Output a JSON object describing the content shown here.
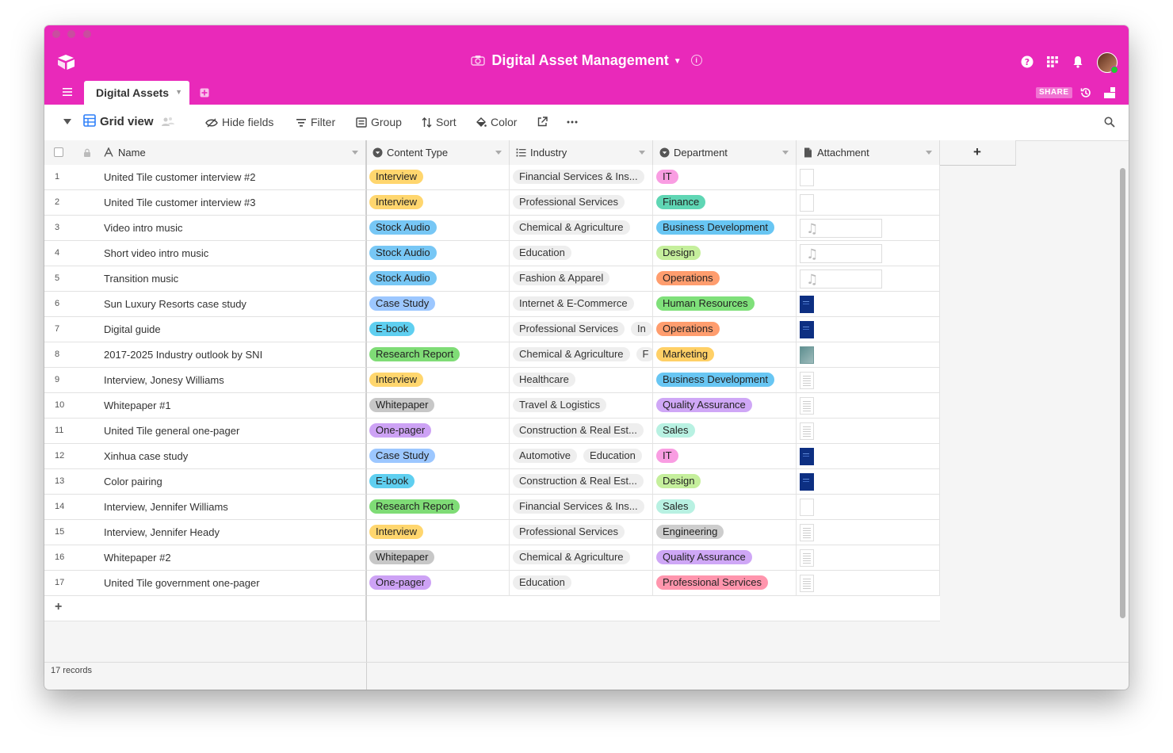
{
  "window": {
    "title": "Digital Asset Management"
  },
  "tabs": [
    {
      "label": "Digital Assets",
      "active": true
    }
  ],
  "share_label": "SHARE",
  "toolbar": {
    "view_name": "Grid view",
    "hide_fields": "Hide fields",
    "filter": "Filter",
    "group": "Group",
    "sort": "Sort",
    "color": "Color"
  },
  "columns": {
    "name": "Name",
    "content_type": "Content Type",
    "industry": "Industry",
    "department": "Department",
    "attachment": "Attachment",
    "add": "+"
  },
  "colors": {
    "titlebar": "#e929ba",
    "Interview": "#ffd66e",
    "Stock Audio": "#77c7f5",
    "Case Study": "#9cc7ff",
    "E-book": "#5fcff0",
    "Research Report": "#7fdc76",
    "Whitepaper": "#c7c7c7",
    "One-pager": "#cda2f5",
    "IT": "#f99de2",
    "Finance": "#5fd6b4",
    "Business Development": "#68c6f3",
    "Design": "#c5ef9c",
    "Operations": "#ff9d6e",
    "Human Resources": "#7fe07a",
    "Marketing": "#ffd066",
    "Quality Assurance": "#cfa7f6",
    "Sales": "#b8f1e2",
    "Engineering": "#cdcdcd",
    "Professional Services": "#ff95ad"
  },
  "rows": [
    {
      "num": "1",
      "name": "United Tile customer interview #2",
      "content_type": "Interview",
      "industry": [
        "Financial Services & Ins..."
      ],
      "department": "IT",
      "attachment": "doc-blank"
    },
    {
      "num": "2",
      "name": "United Tile customer interview #3",
      "content_type": "Interview",
      "industry": [
        "Professional Services"
      ],
      "department": "Finance",
      "attachment": "doc-blank"
    },
    {
      "num": "3",
      "name": "Video intro music",
      "content_type": "Stock Audio",
      "industry": [
        "Chemical & Agriculture"
      ],
      "department": "Business Development",
      "attachment": "audio"
    },
    {
      "num": "4",
      "name": "Short video intro music",
      "content_type": "Stock Audio",
      "industry": [
        "Education"
      ],
      "department": "Design",
      "attachment": "audio"
    },
    {
      "num": "5",
      "name": "Transition music",
      "content_type": "Stock Audio",
      "industry": [
        "Fashion & Apparel"
      ],
      "department": "Operations",
      "attachment": "audio"
    },
    {
      "num": "6",
      "name": "Sun Luxury Resorts case study",
      "content_type": "Case Study",
      "industry": [
        "Internet & E-Commerce"
      ],
      "department": "Human Resources",
      "attachment": "cover"
    },
    {
      "num": "7",
      "name": "Digital guide",
      "content_type": "E-book",
      "industry": [
        "Professional Services",
        "In"
      ],
      "department": "Operations",
      "attachment": "cover"
    },
    {
      "num": "8",
      "name": "2017-2025 Industry outlook by SNI",
      "content_type": "Research Report",
      "industry": [
        "Chemical & Agriculture",
        "F"
      ],
      "department": "Marketing",
      "attachment": "photo"
    },
    {
      "num": "9",
      "name": "Interview, Jonesy Williams",
      "content_type": "Interview",
      "industry": [
        "Healthcare"
      ],
      "department": "Business Development",
      "attachment": "doc"
    },
    {
      "num": "10",
      "name": "Whitepaper #1",
      "content_type": "Whitepaper",
      "industry": [
        "Travel & Logistics"
      ],
      "department": "Quality Assurance",
      "attachment": "doc"
    },
    {
      "num": "11",
      "name": "United Tile general one-pager",
      "content_type": "One-pager",
      "industry": [
        "Construction & Real Est..."
      ],
      "department": "Sales",
      "attachment": "doc"
    },
    {
      "num": "12",
      "name": "Xinhua case study",
      "content_type": "Case Study",
      "industry": [
        "Automotive",
        "Education"
      ],
      "department": "IT",
      "attachment": "cover"
    },
    {
      "num": "13",
      "name": "Color pairing",
      "content_type": "E-book",
      "industry": [
        "Construction & Real Est..."
      ],
      "department": "Design",
      "attachment": "cover"
    },
    {
      "num": "14",
      "name": "Interview, Jennifer Williams",
      "content_type": "Research Report",
      "industry": [
        "Financial Services & Ins..."
      ],
      "department": "Sales",
      "attachment": "doc-blank"
    },
    {
      "num": "15",
      "name": "Interview, Jennifer Heady",
      "content_type": "Interview",
      "industry": [
        "Professional Services"
      ],
      "department": "Engineering",
      "attachment": "doc"
    },
    {
      "num": "16",
      "name": "Whitepaper #2",
      "content_type": "Whitepaper",
      "industry": [
        "Chemical & Agriculture"
      ],
      "department": "Quality Assurance",
      "attachment": "doc"
    },
    {
      "num": "17",
      "name": "United Tile government one-pager",
      "content_type": "One-pager",
      "industry": [
        "Education"
      ],
      "department": "Professional Services",
      "attachment": "doc"
    }
  ],
  "add_row_label": "+",
  "footer": {
    "records": "17 records"
  }
}
